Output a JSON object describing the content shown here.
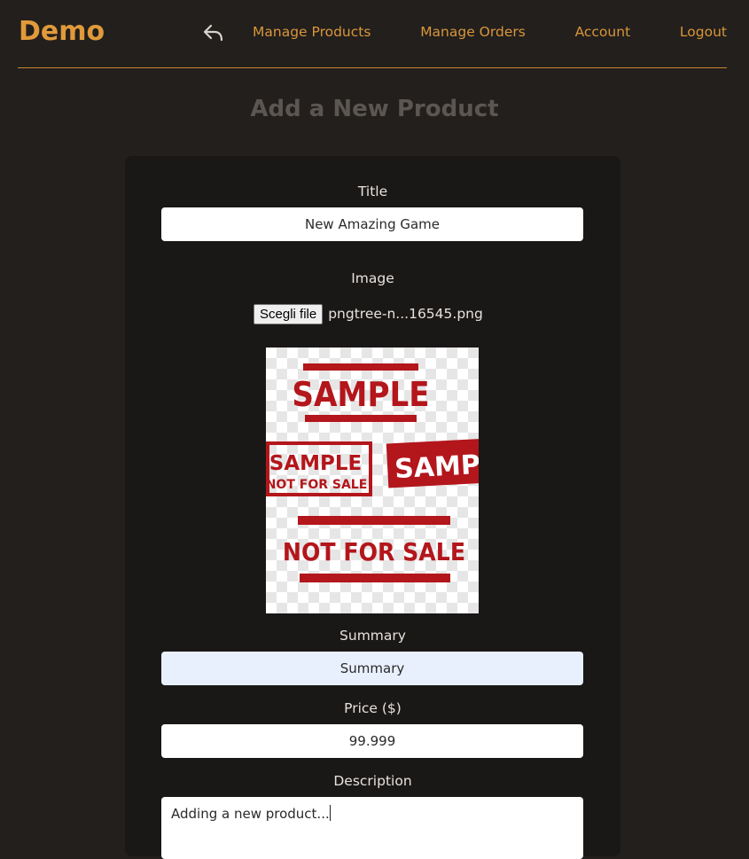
{
  "navbar": {
    "brand": "Demo",
    "back_icon": "reply-arrow-icon",
    "links": [
      "Manage Products",
      "Manage Orders",
      "Account",
      "Logout"
    ]
  },
  "page": {
    "title": "Add a New Product"
  },
  "form": {
    "title_label": "Title",
    "title_value": "New Amazing Game",
    "image_label": "Image",
    "file_button": "Scegli file",
    "file_name": "pngtree-n...16545.png",
    "preview_texts": {
      "stamp1": "SAMPLE",
      "stamp2_line1": "SAMPLE",
      "stamp2_line2": "NOT FOR SALE",
      "stamp3": "SAMPLE",
      "stamp4": "NOT FOR SALE"
    },
    "summary_label": "Summary",
    "summary_value": "Summary",
    "price_label": "Price ($)",
    "price_value": "99.999",
    "description_label": "Description",
    "description_value": "Adding a new product..."
  },
  "colors": {
    "background": "#221f1d",
    "card": "#1a1817",
    "accent": "#e09a3a",
    "nav_link": "#d9963a",
    "title_muted": "#5b5652",
    "stamp_red": "#b3161b"
  }
}
